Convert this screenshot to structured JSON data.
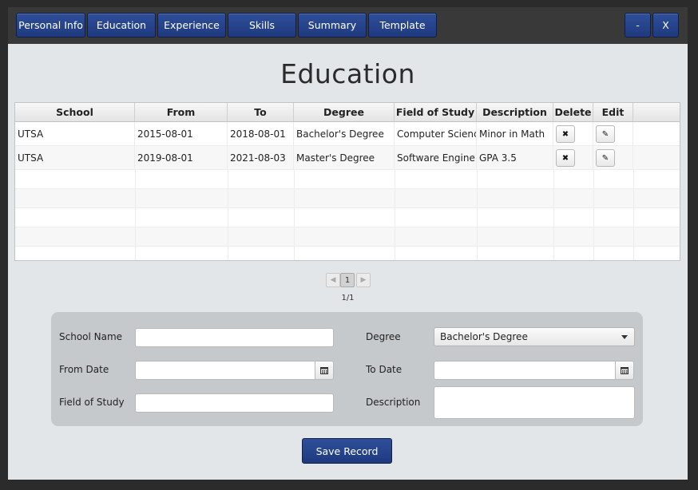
{
  "nav": {
    "tabs": [
      "Personal Info",
      "Education",
      "Experience",
      "Skills",
      "Summary",
      "Template"
    ],
    "minimize_label": "-",
    "close_label": "X"
  },
  "page": {
    "title": "Education"
  },
  "table": {
    "columns": [
      "School",
      "From",
      "To",
      "Degree",
      "Field of Study",
      "Description",
      "Delete",
      "Edit"
    ],
    "rows": [
      {
        "school": "UTSA",
        "from": "2015-08-01",
        "to": "2018-08-01",
        "degree": "Bachelor's Degree",
        "field": "Computer Science",
        "description": "Minor in Math"
      },
      {
        "school": "UTSA",
        "from": "2019-08-01",
        "to": "2021-08-03",
        "degree": "Master's Degree",
        "field": "Software Engine...",
        "description": "GPA 3.5"
      }
    ],
    "delete_glyph": "✖",
    "edit_glyph": "✎"
  },
  "pagination": {
    "current": "1",
    "info": "1/1",
    "prev_glyph": "◀",
    "next_glyph": "▶"
  },
  "form": {
    "school_name_label": "School Name",
    "from_date_label": "From Date",
    "field_of_study_label": "Field of Study",
    "degree_label": "Degree",
    "to_date_label": "To Date",
    "description_label": "Description",
    "degree_selected": "Bachelor's Degree",
    "school_name_value": "",
    "from_date_value": "",
    "to_date_value": "",
    "field_of_study_value": "",
    "description_value": ""
  },
  "save_button_label": "Save Record",
  "colors": {
    "accent": "#223f84",
    "panel": "#c6c9cc",
    "background": "#e3e6e9"
  }
}
